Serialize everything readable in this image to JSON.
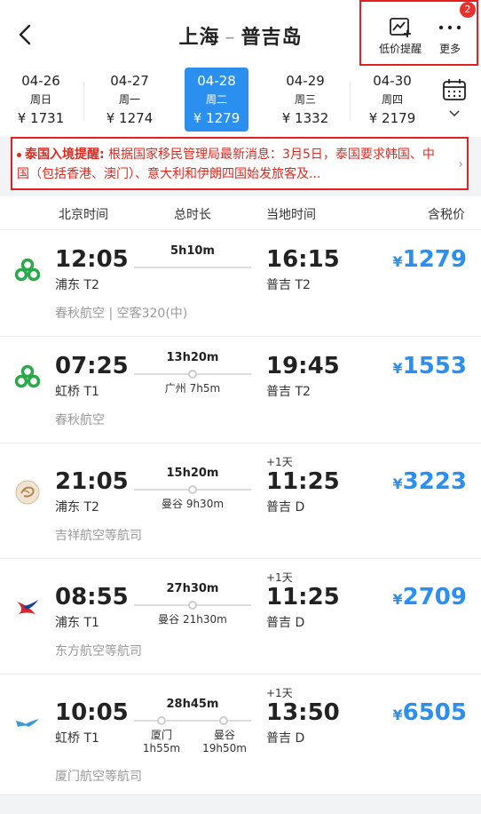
{
  "header": {
    "origin": "上海",
    "dash": "–",
    "destination": "普吉岛",
    "low_price_label": "低价提醒",
    "more_label": "更多",
    "badge_count": "2"
  },
  "dates": [
    {
      "date": "04-26",
      "weekday": "周日",
      "price": "¥ 1731",
      "active": false
    },
    {
      "date": "04-27",
      "weekday": "周一",
      "price": "¥ 1274",
      "active": false
    },
    {
      "date": "04-28",
      "weekday": "周二",
      "price": "¥ 1279",
      "active": true
    },
    {
      "date": "04-29",
      "weekday": "周三",
      "price": "¥ 1332",
      "active": false
    },
    {
      "date": "04-30",
      "weekday": "周四",
      "price": "¥ 2179",
      "active": false
    }
  ],
  "notice": {
    "title": "泰国入境提醒:",
    "text": " 根据国家移民管理局最新消息：3月5日，泰国要求韩国、中国（包括香港、澳门）、意大利和伊朗四国始发旅客及..."
  },
  "columns": {
    "beijing_time": "北京时间",
    "duration": "总时长",
    "local_time": "当地时间",
    "price": "含税价"
  },
  "flights": [
    {
      "dep_time": "12:05",
      "dep_airport": "浦东 T2",
      "duration": "5h10m",
      "arr_time": "16:15",
      "arr_airport": "普吉 T2",
      "plus_day": "",
      "currency": "¥",
      "price": "1279",
      "airline": "春秋航空 | 空客320(中)",
      "stops": []
    },
    {
      "dep_time": "07:25",
      "dep_airport": "虹桥 T1",
      "duration": "13h20m",
      "arr_time": "19:45",
      "arr_airport": "普吉 T2",
      "plus_day": "",
      "currency": "¥",
      "price": "1553",
      "airline": "春秋航空",
      "stops": [
        {
          "city": "广州",
          "wait": "7h5m"
        }
      ]
    },
    {
      "dep_time": "21:05",
      "dep_airport": "浦东 T2",
      "duration": "15h20m",
      "arr_time": "11:25",
      "arr_airport": "普吉 D",
      "plus_day": "+1天",
      "currency": "¥",
      "price": "3223",
      "airline": "吉祥航空等航司",
      "stops": [
        {
          "city": "曼谷",
          "wait": "9h30m"
        }
      ]
    },
    {
      "dep_time": "08:55",
      "dep_airport": "浦东 T1",
      "duration": "27h30m",
      "arr_time": "11:25",
      "arr_airport": "普吉 D",
      "plus_day": "+1天",
      "currency": "¥",
      "price": "2709",
      "airline": "东方航空等航司",
      "stops": [
        {
          "city": "曼谷",
          "wait": "21h30m"
        }
      ]
    },
    {
      "dep_time": "10:05",
      "dep_airport": "虹桥 T1",
      "duration": "28h45m",
      "arr_time": "13:50",
      "arr_airport": "普吉 D",
      "plus_day": "+1天",
      "currency": "¥",
      "price": "6505",
      "airline": "厦门航空等航司",
      "stops": [
        {
          "city": "厦门",
          "wait": "1h55m"
        },
        {
          "city": "曼谷",
          "wait": "19h50m"
        }
      ]
    }
  ],
  "colors": {
    "accent": "#2b8ff0",
    "alert": "#e0281f",
    "spring_green": "#2aa84a",
    "china_eastern_red": "#d7252c",
    "xiamen_blue": "#3d9ad8"
  }
}
